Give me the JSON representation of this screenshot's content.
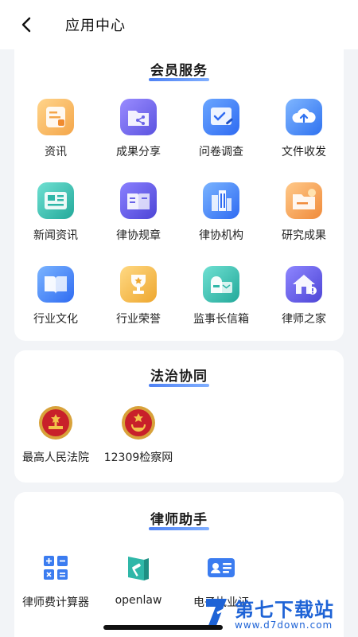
{
  "header": {
    "title": "应用中心",
    "back_icon": "chevron-left-icon"
  },
  "sections": [
    {
      "title": "会员服务",
      "items": [
        {
          "label": "资讯",
          "icon": "news-card-icon"
        },
        {
          "label": "成果分享",
          "icon": "folder-share-icon"
        },
        {
          "label": "问卷调查",
          "icon": "survey-icon"
        },
        {
          "label": "文件收发",
          "icon": "cloud-upload-icon"
        },
        {
          "label": "新闻资讯",
          "icon": "newspaper-icon"
        },
        {
          "label": "律协规章",
          "icon": "book-rules-icon"
        },
        {
          "label": "律协机构",
          "icon": "building-icon"
        },
        {
          "label": "研究成果",
          "icon": "research-folder-icon"
        },
        {
          "label": "行业文化",
          "icon": "open-book-icon"
        },
        {
          "label": "行业荣誉",
          "icon": "trophy-icon"
        },
        {
          "label": "监事长信箱",
          "icon": "mailbox-icon"
        },
        {
          "label": "律师之家",
          "icon": "home-icon"
        }
      ]
    },
    {
      "title": "法治协同",
      "items": [
        {
          "label": "最高人民法院",
          "icon": "court-emblem-icon"
        },
        {
          "label": "12309检察网",
          "icon": "procuratorate-emblem-icon"
        }
      ]
    },
    {
      "title": "律师助手",
      "items": [
        {
          "label": "律师费计算器",
          "icon": "calculator-icon"
        },
        {
          "label": "openlaw",
          "icon": "gavel-book-icon"
        },
        {
          "label": "电子执业证",
          "icon": "id-card-icon"
        }
      ]
    }
  ],
  "watermark": {
    "name": "第七下载站",
    "url": "www.d7down.com"
  },
  "colors": {
    "accent": "#2f6bf2",
    "orange": "#f4a64a",
    "purple": "#6a63e8",
    "blue": "#3b7cf0",
    "teal": "#2fb7a8",
    "gold": "#f3b43c",
    "emblem_red": "#c8202a"
  }
}
